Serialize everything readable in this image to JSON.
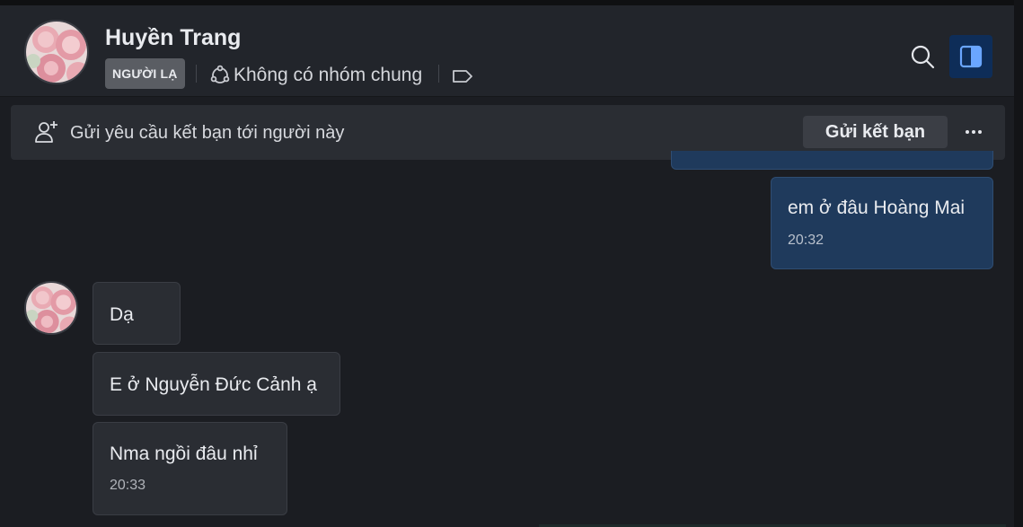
{
  "header": {
    "contact_name": "Huyền Trang",
    "badge": "NGƯỜI LẠ",
    "group_status": "Không có nhóm chung",
    "icons": {
      "avatar": "rose-photo-avatar",
      "group": "group-circle-icon",
      "tag": "label-tag-icon",
      "search": "search-icon",
      "panel": "sidebar-panel-icon"
    },
    "accent_color": "#0e2d58"
  },
  "friend_request": {
    "text": "Gửi yêu cầu kết bạn tới người này",
    "button": "Gửi kết bạn",
    "icons": {
      "add_user": "add-user-icon",
      "more": "more-dots-icon"
    }
  },
  "messages": {
    "outgoing": [
      {
        "text": "em ở đâu Hoàng Mai",
        "time": "20:32"
      }
    ],
    "incoming": [
      {
        "text": "Dạ"
      },
      {
        "text": "E ở Nguyễn Đức Cảnh ạ"
      },
      {
        "text": "Nma ngồi đâu nhỉ",
        "time": "20:33"
      }
    ]
  },
  "colors": {
    "background": "#1b1d22",
    "header": "#22252b",
    "outgoing_bubble": "#1f3a5c",
    "incoming_bubble": "#2a2d33"
  }
}
